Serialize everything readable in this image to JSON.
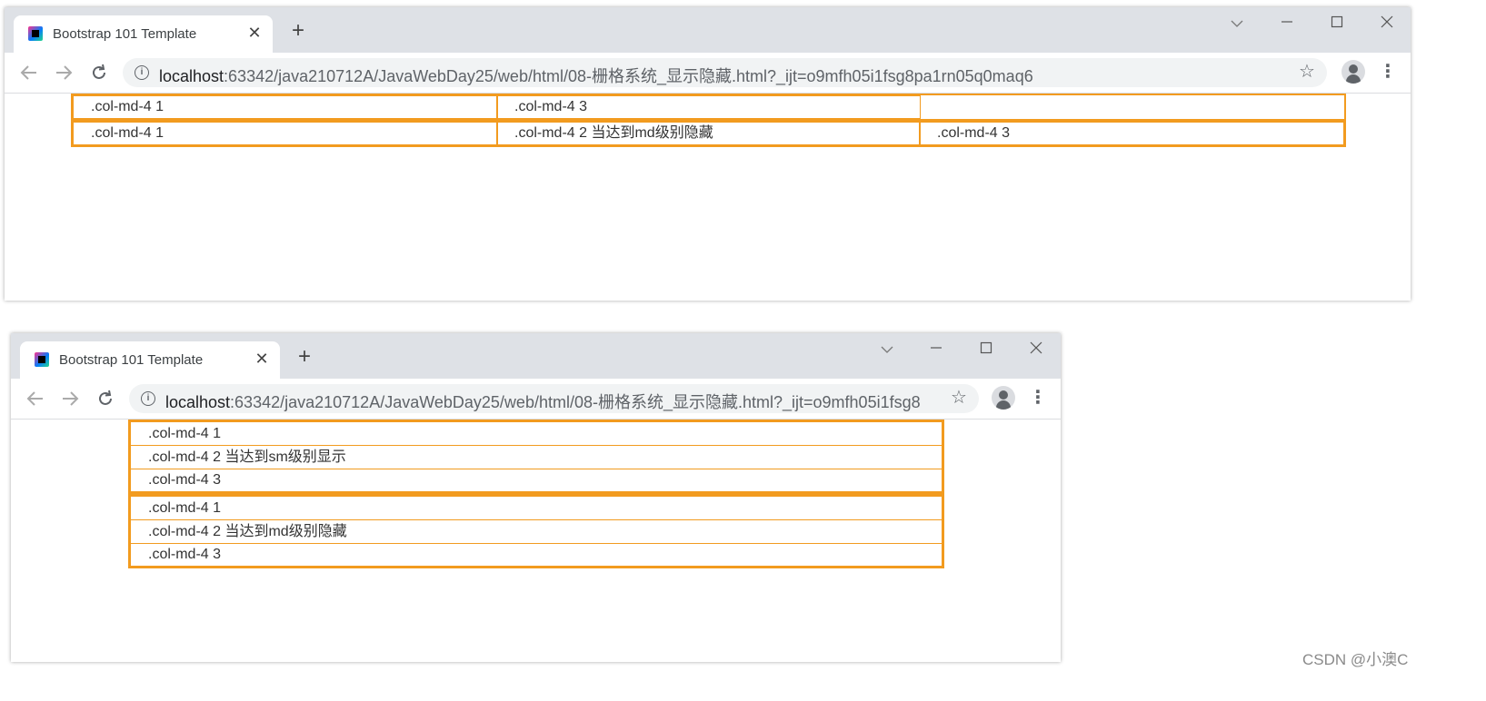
{
  "windows": [
    {
      "tab_title": "Bootstrap 101 Template",
      "url_host": "localhost",
      "url_rest": ":63342/java210712A/JavaWebDay25/web/html/08-栅格系统_显示隐藏.html?_ijt=o9mfh05i1fsg8pa1rn05q0maq6",
      "rows": [
        {
          "cells": [
            ".col-md-4 1",
            ".col-md-4 3",
            ""
          ]
        },
        {
          "cells": [
            ".col-md-4 1",
            ".col-md-4 2 当达到md级别隐藏",
            ".col-md-4 3"
          ]
        }
      ]
    },
    {
      "tab_title": "Bootstrap 101 Template",
      "url_host": "localhost",
      "url_rest": ":63342/java210712A/JavaWebDay25/web/html/08-栅格系统_显示隐藏.html?_ijt=o9mfh05i1fsg8...",
      "rows": [
        {
          "cells": [
            ".col-md-4 1",
            ".col-md-4 2 当达到sm级别显示",
            ".col-md-4 3"
          ]
        },
        {
          "cells": [
            ".col-md-4 1",
            ".col-md-4 2 当达到md级别隐藏",
            ".col-md-4 3"
          ]
        }
      ]
    }
  ],
  "icons": {
    "back": "back-arrow-icon",
    "forward": "forward-arrow-icon",
    "reload": "reload-icon",
    "info": "info-icon",
    "bookmark": "star-icon",
    "profile": "avatar-icon",
    "menu": "kebab-menu-icon"
  },
  "colors": {
    "grid_border": "#f29b1f",
    "tab_strip": "#dee1e6",
    "omnibox": "#f1f3f4"
  },
  "watermark": "CSDN @小澳C"
}
